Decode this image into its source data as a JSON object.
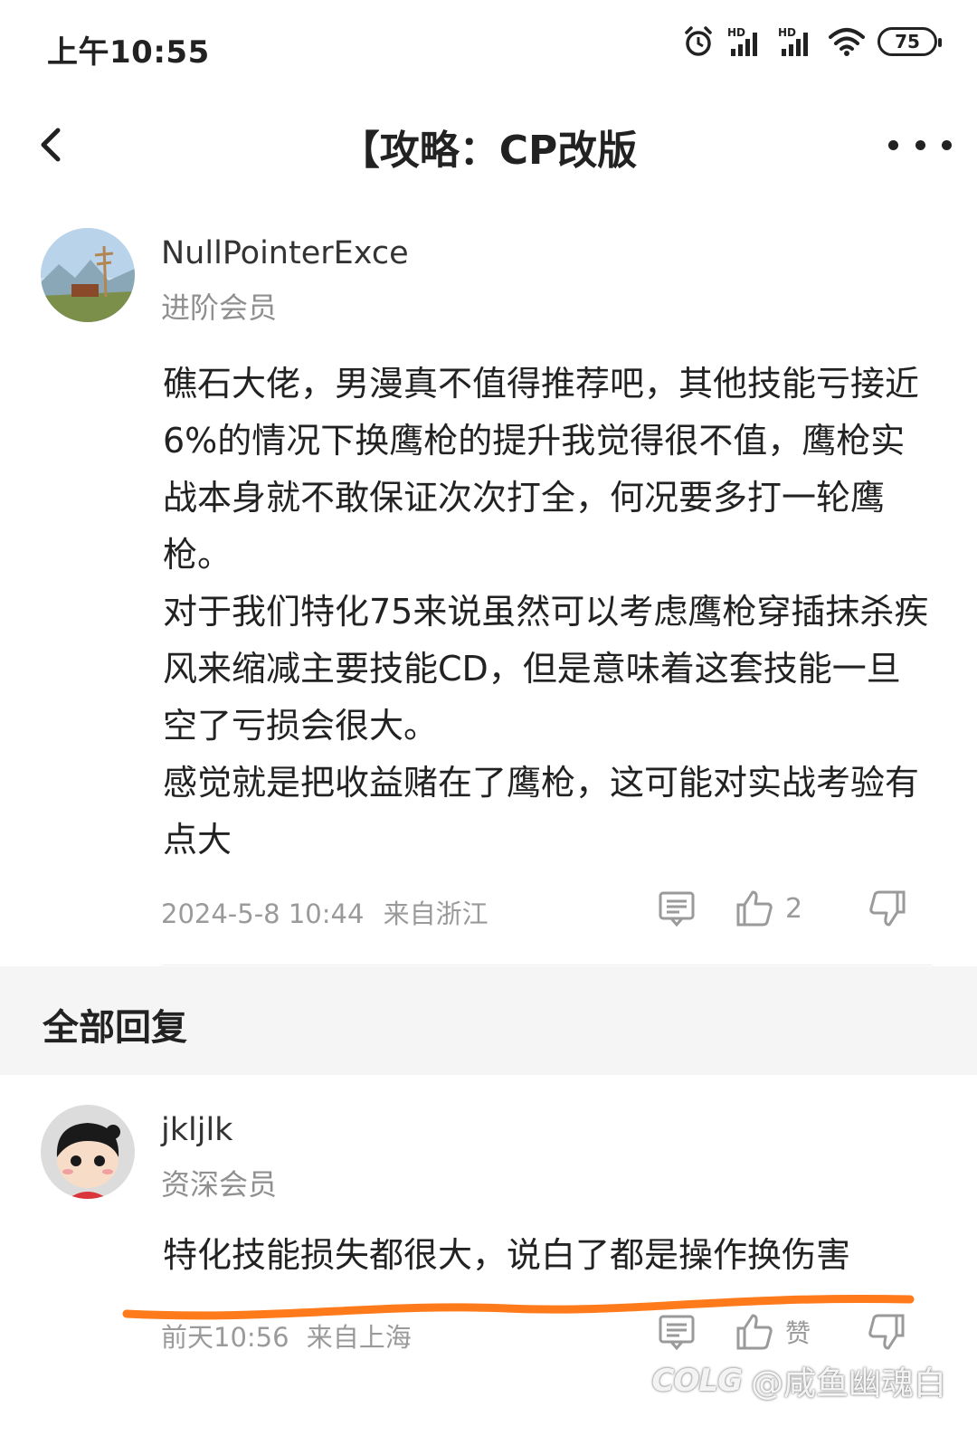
{
  "status_bar": {
    "time": "上午10:55",
    "icons": [
      "alarm-icon",
      "signal-hd-icon",
      "signal-hd-icon",
      "wifi-icon"
    ],
    "battery": "75"
  },
  "nav": {
    "back_icon": "chevron-left-icon",
    "title": "【攻略：CP改版",
    "more_icon": "more-dots-icon"
  },
  "post": {
    "author": "NullPointerExce",
    "rank": "进阶会员",
    "paragraphs": [
      "礁石大佬，男漫真不值得推荐吧，其他技能亏接近6%的情况下换鹰枪的提升我觉得很不值，鹰枪实战本身就不敢保证次次打全，何况要多打一轮鹰枪。",
      "对于我们特化75来说虽然可以考虑鹰枪穿插抹杀疾风来缩减主要技能CD，但是意味着这套技能一旦空了亏损会很大。",
      "感觉就是把收益赌在了鹰枪，这可能对实战考验有点大"
    ],
    "time": "2024-5-8 10:44",
    "location": "来自浙江",
    "like_count": "2"
  },
  "replies_section": {
    "title": "全部回复"
  },
  "reply": {
    "author": "jkljlk",
    "rank": "资深会员",
    "text": "特化技能损失都很大，说白了都是操作换伤害",
    "time": "前天10:56",
    "location": "来自上海",
    "like_label": "赞"
  },
  "watermark": {
    "logo": "COLG",
    "handle": "@咸鱼幽魂白"
  },
  "colors": {
    "text": "#222222",
    "muted": "#9a9a9a",
    "section_bg": "#f5f5f5",
    "annotation": "#ff7a1a"
  }
}
